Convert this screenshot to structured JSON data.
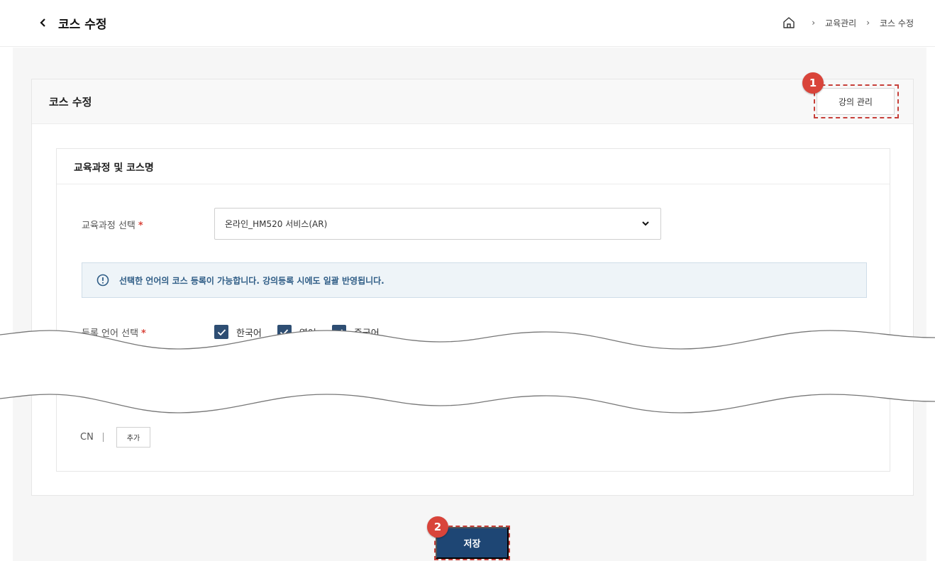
{
  "header": {
    "title": "코스 수정",
    "breadcrumb": [
      "교육관리",
      "코스 수정"
    ]
  },
  "card": {
    "title": "코스 수정",
    "lecture_button": "강의 관리"
  },
  "section": {
    "title": "교육과정 및 코스명",
    "course_label": "교육과정 선택",
    "course_value": "온라인_HM520 서비스(AR)",
    "info_text": "선택한 언어의 코스 등록이 가능합니다. 강의등록 시에도 일괄 반영됩니다.",
    "lang_label": "등록 언어 선택",
    "languages": [
      "한국어",
      "영어",
      "중국어"
    ],
    "required_mark": "*",
    "lang_rows": [
      {
        "code": "CN",
        "button": "추가"
      }
    ]
  },
  "footer": {
    "save_label": "저장"
  },
  "annotations": [
    "1",
    "2"
  ],
  "colors": {
    "accent": "#1e4674",
    "checkbox": "#2e4e73",
    "highlight": "#d9443a",
    "info_text": "#2f5d86"
  }
}
